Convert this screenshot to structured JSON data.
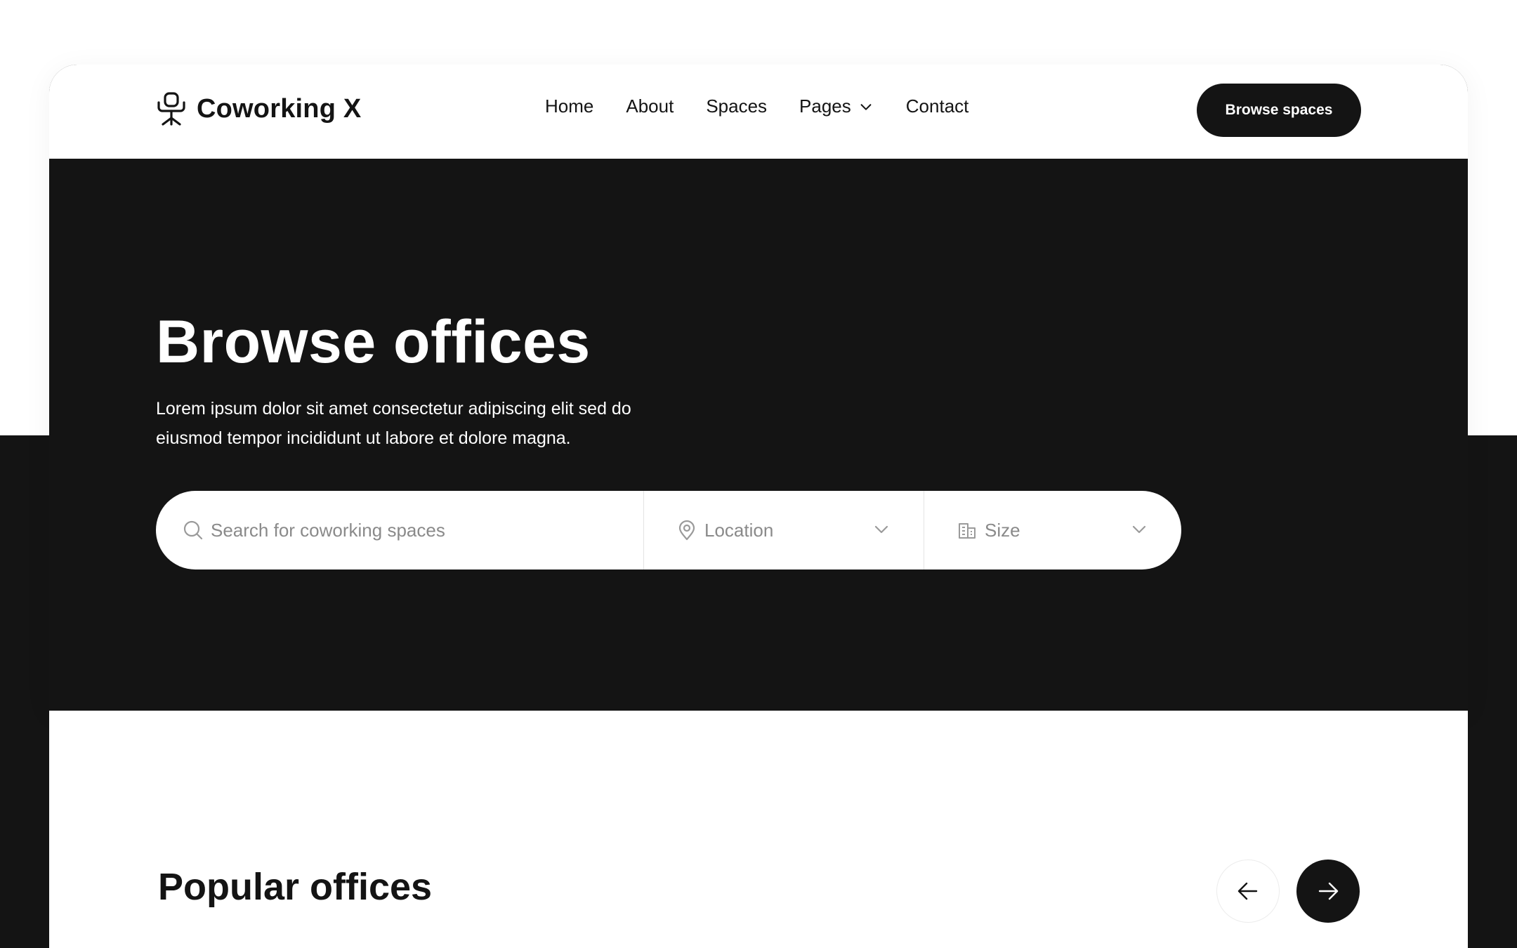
{
  "brand": {
    "name": "Coworking X",
    "icon": "office-chair-icon"
  },
  "nav": {
    "items": [
      {
        "label": "Home"
      },
      {
        "label": "About"
      },
      {
        "label": "Spaces"
      },
      {
        "label": "Pages",
        "has_dropdown": true
      },
      {
        "label": "Contact"
      }
    ],
    "cta_label": "Browse spaces"
  },
  "hero": {
    "title": "Browse offices",
    "subtitle": "Lorem ipsum dolor sit amet consectetur adipiscing elit sed do eiusmod tempor incididunt ut labore et dolore magna."
  },
  "search": {
    "placeholder": "Search for coworking spaces",
    "location_label": "Location",
    "size_label": "Size"
  },
  "popular": {
    "title": "Popular offices"
  },
  "colors": {
    "dark": "#141414",
    "light": "#ffffff",
    "muted_text": "#8a8a8a"
  }
}
